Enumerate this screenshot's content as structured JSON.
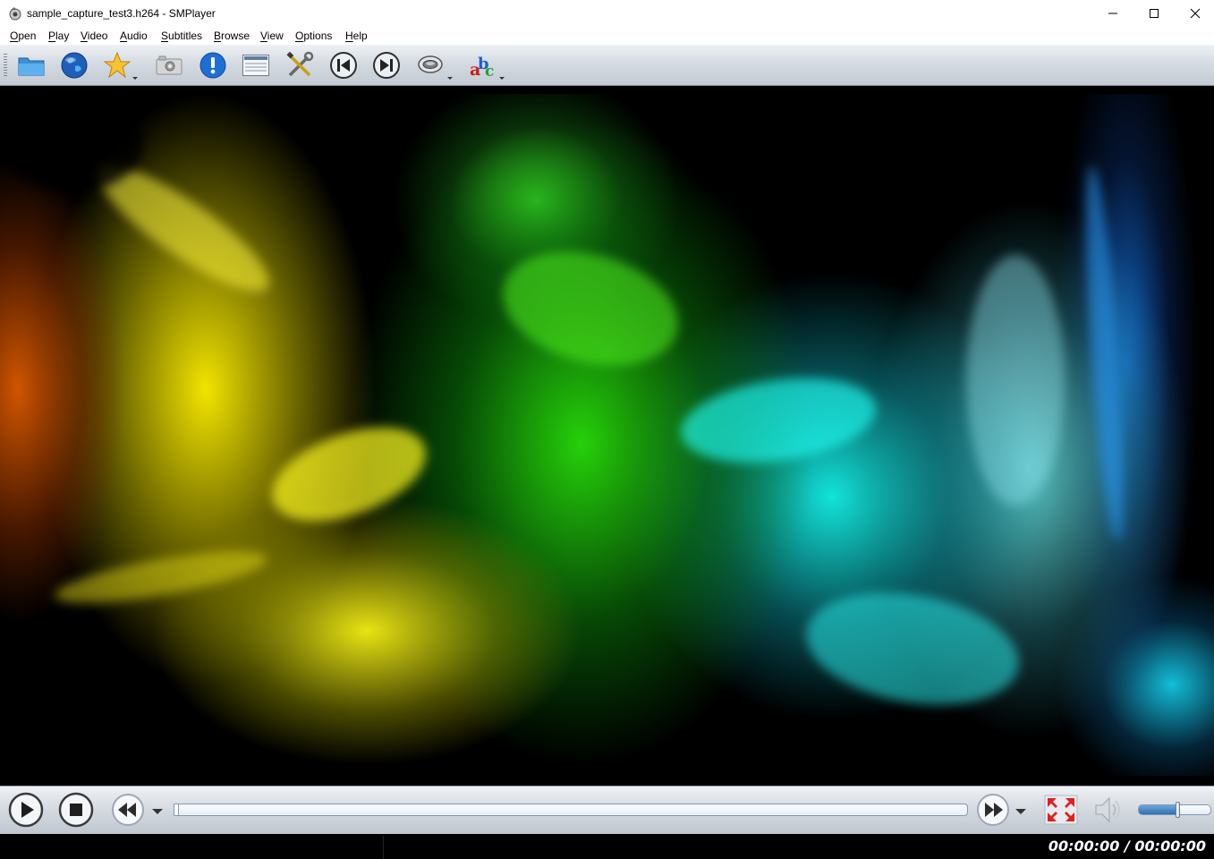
{
  "window": {
    "title": "sample_capture_test3.h264 - SMPlayer",
    "app_icon": "smplayer-icon",
    "controls": [
      "minimize-icon",
      "maximize-icon",
      "close-icon"
    ]
  },
  "menubar": {
    "items": [
      {
        "label": "Open",
        "accel": "O",
        "rest": "pen"
      },
      {
        "label": "Play",
        "accel": "P",
        "rest": "lay"
      },
      {
        "label": "Video",
        "accel": "V",
        "rest": "ideo"
      },
      {
        "label": "Audio",
        "accel": "A",
        "rest": "udio"
      },
      {
        "label": "Subtitles",
        "accel": "S",
        "rest": "ubtitles"
      },
      {
        "label": "Browse",
        "accel": "B",
        "rest": "rowse"
      },
      {
        "label": "View",
        "accel": "V",
        "rest": "iew"
      },
      {
        "label": "Options",
        "accel": "O",
        "rest": "ptions"
      },
      {
        "label": "Help",
        "accel": "H",
        "rest": "elp"
      }
    ]
  },
  "toolbar": {
    "buttons": [
      "open-folder-icon",
      "open-url-globe-icon",
      "favorites-star-icon",
      "screenshot-camera-icon",
      "info-icon",
      "playlist-icon",
      "preferences-tools-icon",
      "previous-icon",
      "next-icon",
      "audio-track-icon",
      "subtitles-abc-icon"
    ]
  },
  "controls": {
    "buttons": [
      "play-icon",
      "stop-icon",
      "rewind-icon",
      "forward-icon",
      "fullscreen-icon",
      "mute-speaker-icon"
    ],
    "seek_progress": 0.0,
    "volume_level": 0.55
  },
  "status": {
    "time": "00:00:00 / 00:00:00"
  },
  "colors": {
    "toolbar_gradient_top": "#eef1f5",
    "toolbar_gradient_bottom": "#c3cad3",
    "seek_border": "#7f98b3",
    "volume_fill": "#2f6fb0"
  }
}
